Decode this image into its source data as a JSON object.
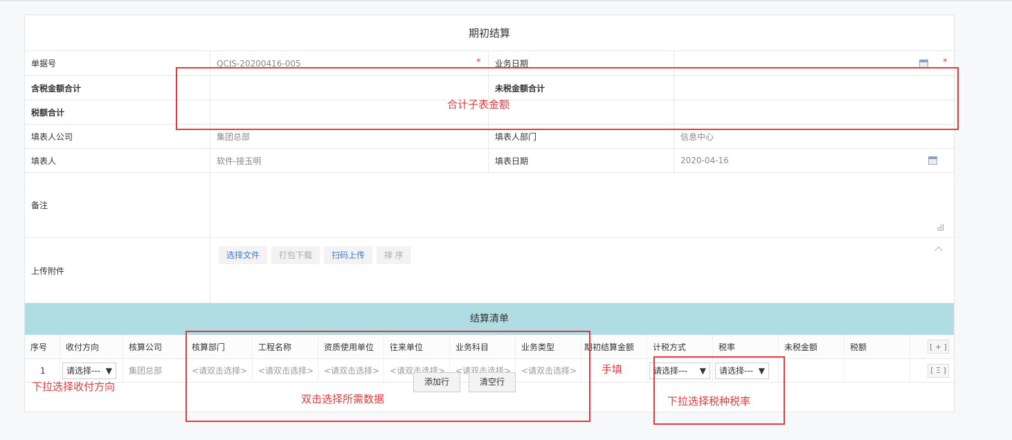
{
  "page": {
    "title": "期初结算"
  },
  "form": {
    "doc_no_label": "单据号",
    "doc_no_value": "QCJS-20200416-005",
    "biz_date_label": "业务日期",
    "biz_date_value": "",
    "tax_incl_total_label": "含税金额合计",
    "tax_excl_total_label": "未税金额合计",
    "tax_total_label": "税额合计",
    "company_label": "填表人公司",
    "company_value": "集团总部",
    "dept_label": "填表人部门",
    "dept_value": "信息中心",
    "filler_label": "填表人",
    "filler_value": "软件-接玉明",
    "fill_date_label": "填表日期",
    "fill_date_value": "2020-04-16",
    "remark_label": "备注",
    "attach_label": "上传附件",
    "required_mark": "*"
  },
  "upload": {
    "choose_file": "选择文件",
    "pack_download": "打包下载",
    "scan_upload": "扫码上传",
    "sort": "排 序"
  },
  "settlement": {
    "title": "结算清单",
    "columns": [
      "序号",
      "收付方向",
      "核算公司",
      "核算部门",
      "工程名称",
      "资质使用单位",
      "往来单位",
      "业务科目",
      "业务类型",
      "期初结算金额",
      "计税方式",
      "税率",
      "未税金额",
      "税额"
    ],
    "add_col_icon": "[ + ]",
    "row": {
      "index": "1",
      "direction": "请选择---",
      "company": "集团总部",
      "dept": "<请双击选择>",
      "project": "<请双击选择>",
      "qualification_unit": "<请双击选择>",
      "counterparty": "<请双击选择>",
      "subject": "<请双击选择>",
      "biz_type": "<请双击选择>",
      "tax_method": "请选择---",
      "tax_rate": "请选择---",
      "row_menu_icon": "[ Ξ ]"
    },
    "add_row": "添加行",
    "clear_rows": "清空行"
  },
  "annotations": {
    "sum_note": "合计子表金额",
    "direction_note": "下拉选择收付方向",
    "dblclick_note": "双击选择所需数据",
    "manual_note": "手填",
    "tax_note": "下拉选择税种税率"
  },
  "colors": {
    "annotation": "#e3383c",
    "section_header": "#b0dde3",
    "link_blue": "#3b7bd6"
  }
}
